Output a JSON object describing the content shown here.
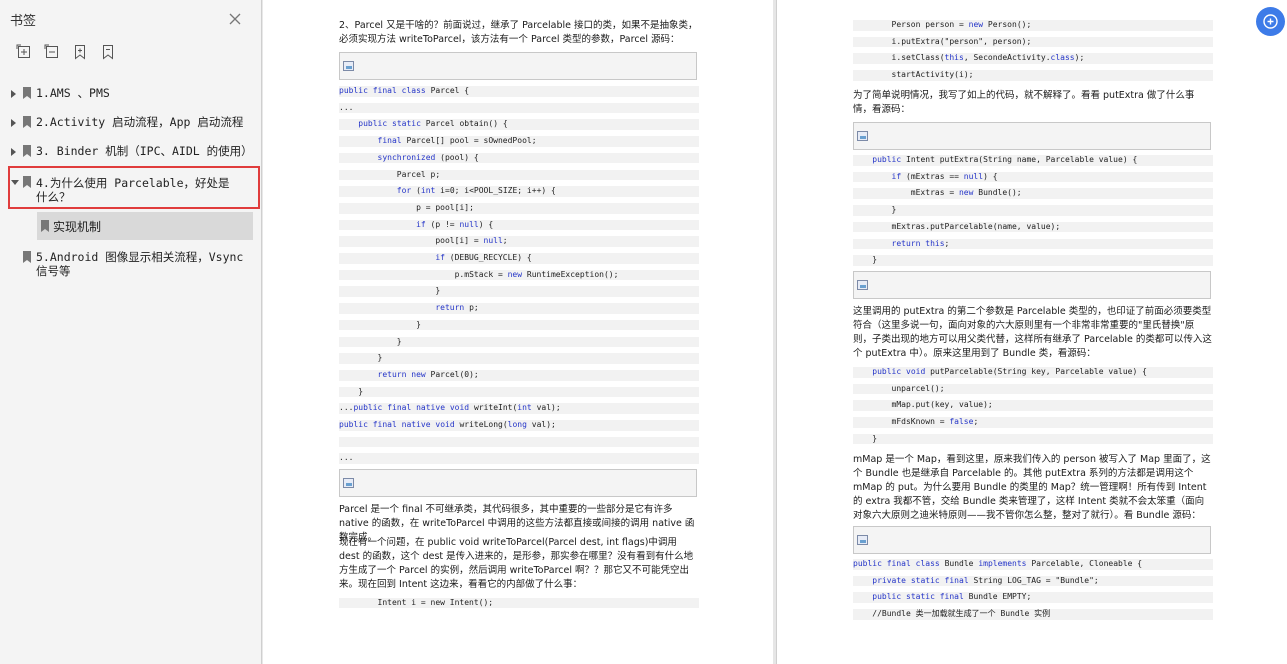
{
  "sidebar": {
    "title": "书签",
    "toolbar": [
      "expand-all",
      "collapse-all",
      "add-bookmark",
      "bookmark-options"
    ],
    "items": [
      {
        "label": "1.AMS 、PMS"
      },
      {
        "label": "2.Activity 启动流程，App 启动流程"
      },
      {
        "label": "3. Binder 机制（IPC、AIDL 的使用）"
      },
      {
        "label": "4.为什么使用 Parcelable，好处是什么？"
      },
      {
        "label": "5.Android 图像显示相关流程，Vsync 信号等"
      }
    ],
    "sub_item": "实现机制"
  },
  "page1": {
    "para1": "2、Parcel 又是干啥的？前面说过，继承了 Parcelable 接口的类，如果不是抽象类，必须实现方法 writeToParcel，该方法有一个 Parcel 类型的参数，Parcel 源码：",
    "code1": [
      "public final class Parcel {",
      "...",
      "    public static Parcel obtain() {",
      "        final Parcel[] pool = sOwnedPool;",
      "        synchronized (pool) {",
      "            Parcel p;",
      "            for (int i=0; i<POOL_SIZE; i++) {",
      "                p = pool[i];",
      "                if (p != null) {",
      "                    pool[i] = null;",
      "                    if (DEBUG_RECYCLE) {",
      "                        p.mStack = new RuntimeException();",
      "                    }",
      "                    return p;",
      "                }",
      "            }",
      "        }",
      "        return new Parcel(0);",
      "    }",
      "...public final native void writeInt(int val);",
      "public final native void writeLong(long val);",
      "",
      "..."
    ],
    "para2": "Parcel 是一个 final 不可继承类，其代码很多，其中重要的一些部分是它有许多 native 的函数，在 writeToParcel 中调用的这些方法都直接或间接的调用 native 函数完成。",
    "para3": "现在有一个问题，在 public void writeToParcel(Parcel dest, int flags)中调用 dest 的函数，这个 dest 是传入进来的，是形参，那实参在哪里？没有看到有什么地方生成了一个 Parcel 的实例，然后调用 writeToParcel 啊？？那它又不可能凭空出来。现在回到 Intent 这边来，看看它的内部做了什么事：",
    "code2": "        Intent i = new Intent();"
  },
  "page2": {
    "code1": [
      "        Person person = new Person();",
      "        i.putExtra(\"person\", person);",
      "        i.setClass(this, SecondeActivity.class);",
      "        startActivity(i);"
    ],
    "para1": "为了简单说明情况，我写了如上的代码，就不解释了。看看 putExtra 做了什么事情，看源码：",
    "code2": [
      "    public Intent putExtra(String name, Parcelable value) {",
      "        if (mExtras == null) {",
      "            mExtras = new Bundle();",
      "        }",
      "        mExtras.putParcelable(name, value);",
      "        return this;",
      "    }"
    ],
    "para2": "这里调用的 putExtra 的第二个参数是 Parcelable 类型的，也印证了前面必须要类型符合（这里多说一句，面向对象的六大原则里有一个非常非常重要的\"里氏替换\"原则，子类出现的地方可以用父类代替，这样所有继承了 Parcelable 的类都可以传入这个 putExtra 中）。原来这里用到了 Bundle 类，看源码：",
    "code3": [
      "    public void putParcelable(String key, Parcelable value) {",
      "        unparcel();",
      "        mMap.put(key, value);",
      "        mFdsKnown = false;",
      "    }"
    ],
    "para3": "mMap 是一个 Map，看到这里，原来我们传入的 person 被写入了 Map 里面了，这个 Bundle 也是继承自 Parcelable 的。其他 putExtra 系列的方法都是调用这个 mMap 的 put。为什么要用 Bundle 的类里的 Map？统一管理啊！所有传到 Intent 的 extra 我都不管，交给 Bundle 类来管理了，这样 Intent 类就不会太笨重（面向对象六大原则之迪米特原则——我不管你怎么整，整对了就行）。看 Bundle 源码：",
    "code4": [
      "public final class Bundle implements Parcelable, Cloneable {",
      "    private static final String LOG_TAG = \"Bundle\";",
      "    public static final Bundle EMPTY;",
      "    //Bundle 类一加载就生成了一个 Bundle 实例"
    ]
  },
  "colors": {
    "keyword": "#2535c8",
    "selection_border": "#e03c3c",
    "fab": "#3d7be8"
  },
  "icons": {
    "close": "close-icon",
    "bookmark": "bookmark-icon",
    "fab": "translate-icon"
  }
}
